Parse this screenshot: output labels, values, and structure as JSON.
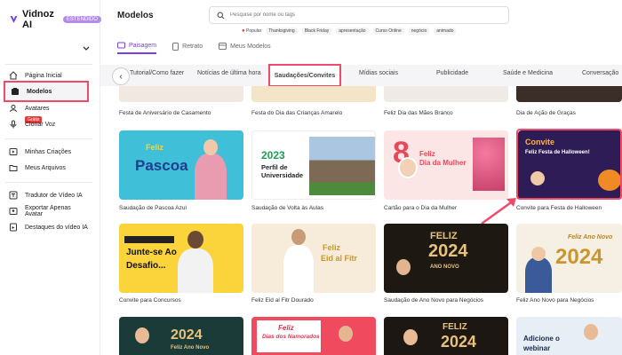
{
  "brand": {
    "name": "Vidnoz AI",
    "badge": "ESTENDIDO"
  },
  "sidebar": {
    "items": [
      {
        "label": "Página Inicial"
      },
      {
        "label": "Modelos"
      },
      {
        "label": "Avatares"
      },
      {
        "label": "Clonar Voz",
        "badge": "Grátis"
      },
      {
        "label": "Minhas Criações"
      },
      {
        "label": "Meus Arquivos"
      },
      {
        "label": "Tradutor de Vídeo IA"
      },
      {
        "label": "Exportar Apenas Avatar"
      },
      {
        "label": "Destaques do vídeo IA"
      }
    ]
  },
  "header": {
    "title": "Modelos",
    "search_placeholder": "Pesquise por nome ou tags",
    "tags": [
      "Popular",
      "Thanksgiving",
      "Black Friday",
      "apresentação",
      "Curso Online",
      "negócio",
      "animado"
    ]
  },
  "top_tabs": [
    {
      "label": "Paisagem"
    },
    {
      "label": "Retrato"
    },
    {
      "label": "Meus Modelos"
    }
  ],
  "categories": [
    "Tutorial/Como fazer",
    "Notícias de última hora",
    "Saudações/Convites",
    "Mídias sociais",
    "Publicidade",
    "Saúde e Medicina",
    "Conversação"
  ],
  "top_row_labels": [
    "Festa de Aniversário de Casamento",
    "Festa do Dia das Crianças Amarelo",
    "Feliz Dia das Mães Branco",
    "Dia de Ação de Graças"
  ],
  "rows": [
    [
      {
        "label": "Saudação de Pascoa Azul",
        "thumb_text": [
          "Feliz",
          "Pascoa"
        ]
      },
      {
        "label": "Saudação de Volta às Aulas",
        "thumb_text": [
          "2023",
          "Perfil de",
          "Universidade"
        ]
      },
      {
        "label": "Cartão para o Dia da Mulher",
        "thumb_text": [
          "Feliz",
          "Dia da Mulher"
        ]
      },
      {
        "label": "Convite para Festa de Halloween",
        "thumb_text": [
          "Convite",
          "Feliz Festa de Halloween!"
        ]
      }
    ],
    [
      {
        "label": "Convite para Concursos",
        "thumb_text": [
          "Junte-se Ao",
          "Desafio..."
        ]
      },
      {
        "label": "Feliz Eid al Fitr Dourado",
        "thumb_text": [
          "Feliz",
          "Eid al Fitr"
        ]
      },
      {
        "label": "Saudação de Ano Novo para Negócios",
        "thumb_text": [
          "FELIZ",
          "2024",
          "ANO NOVO"
        ]
      },
      {
        "label": "Feliz Ano Novo para Negócios",
        "thumb_text": [
          "Feliz Ano Novo",
          "2024"
        ]
      }
    ],
    [
      {
        "label": "",
        "thumb_text": [
          "2024",
          "Feliz Ano Novo"
        ]
      },
      {
        "label": "",
        "thumb_text": [
          "Feliz",
          "Dias dos Namorados"
        ]
      },
      {
        "label": "",
        "thumb_text": [
          "FELIZ",
          "2024"
        ]
      },
      {
        "label": "",
        "thumb_text": [
          "Adicione o",
          "webinar"
        ]
      }
    ]
  ],
  "colors": {
    "accent": "#7a3fe4",
    "highlight": "#ee4b6a"
  }
}
